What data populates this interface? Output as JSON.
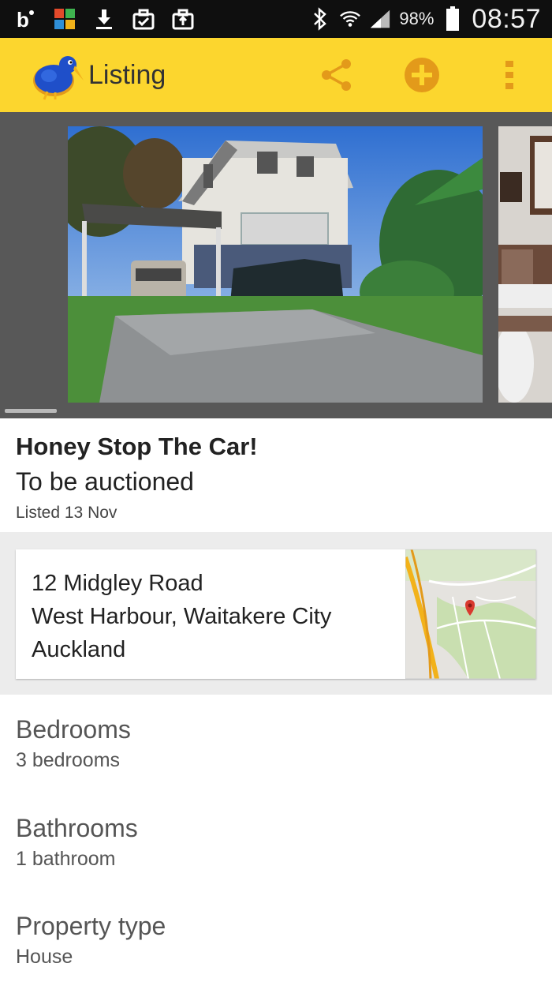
{
  "status_bar": {
    "battery_percent": "98%",
    "time": "08:57",
    "icons": [
      "b-notification-icon",
      "app-grid-icon",
      "download-icon",
      "briefcase-check-icon",
      "briefcase-upload-icon",
      "bluetooth-icon",
      "wifi-icon",
      "signal-icon",
      "battery-icon"
    ]
  },
  "app_bar": {
    "title": "Listing",
    "actions": [
      "share-icon",
      "add-circle-icon",
      "overflow-menu-icon"
    ],
    "colors": {
      "bar": "#fcd62e",
      "accent": "#e39a1a",
      "logo_blue": "#1f4fc9"
    }
  },
  "listing": {
    "title": "Honey Stop The Car!",
    "status": "To be auctioned",
    "listed_date": "Listed 13 Nov"
  },
  "address": {
    "line1": "12 Midgley Road",
    "line2": "West Harbour, Waitakere City",
    "line3": "Auckland"
  },
  "details": [
    {
      "label": "Bedrooms",
      "value": "3 bedrooms"
    },
    {
      "label": "Bathrooms",
      "value": "1 bathroom"
    },
    {
      "label": "Property type",
      "value": "House"
    }
  ]
}
